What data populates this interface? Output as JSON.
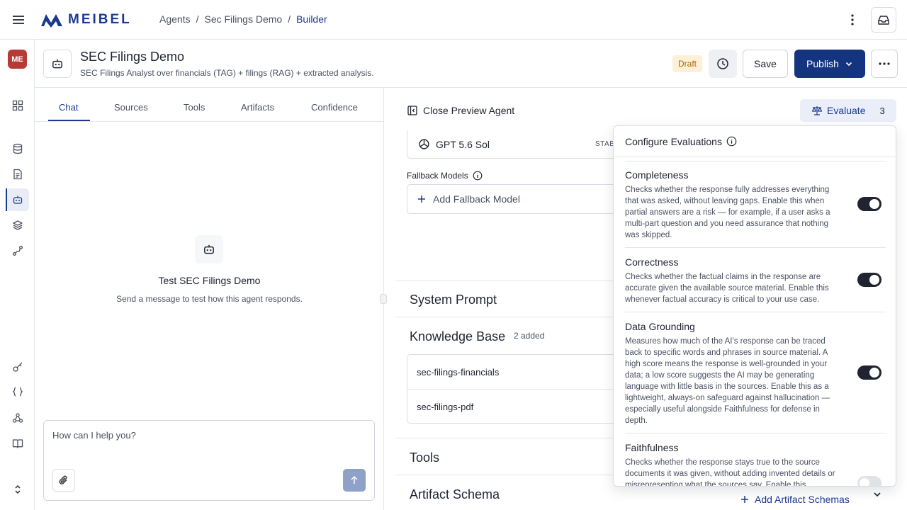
{
  "app": {
    "logo_text": "MEIBEL"
  },
  "breadcrumbs": [
    "Agents",
    "/",
    "Sec Filings Demo",
    "/",
    "Builder"
  ],
  "user": {
    "initials": "ME"
  },
  "agent": {
    "title": "SEC Filings Demo",
    "subtitle": "SEC Filings Analyst over financials (TAG) + filings (RAG) + extracted analysis.",
    "status": "Draft"
  },
  "actions": {
    "save": "Save",
    "publish": "Publish"
  },
  "left_tabs": [
    "Chat",
    "Sources",
    "Tools",
    "Artifacts",
    "Confidence"
  ],
  "chat": {
    "empty_title": "Test SEC Filings Demo",
    "empty_sub": "Send a message to test how this agent responds.",
    "placeholder": "How can I help you?"
  },
  "preview": {
    "close_label": "Close Preview Agent",
    "evaluate_label": "Evaluate",
    "evaluate_count": "3",
    "model_name": "GPT 5.6 Sol",
    "model_tag": "STAB",
    "fallback_label": "Fallback Models",
    "add_fallback": "Add Fallback Model",
    "sections": {
      "system_prompt": "System Prompt",
      "knowledge_base": "Knowledge Base",
      "kb_count": "2 added",
      "tools": "Tools",
      "artifact_schema": "Artifact Schema",
      "add_artifact": "Add Artifact Schemas"
    },
    "kb_items": [
      "sec-filings-financials",
      "sec-filings-pdf"
    ]
  },
  "evaluations": {
    "header": "Configure Evaluations",
    "items": [
      {
        "title": "Completeness",
        "desc": "Checks whether the response fully addresses everything that was asked, without leaving gaps. Enable this when partial answers are a risk — for example, if a user asks a multi-part question and you need assurance that nothing was skipped.",
        "enabled": true
      },
      {
        "title": "Correctness",
        "desc": "Checks whether the factual claims in the response are accurate given the available source material. Enable this whenever factual accuracy is critical to your use case.",
        "enabled": true
      },
      {
        "title": "Data Grounding",
        "desc": "Measures how much of the AI's response can be traced back to specific words and phrases in source material. A high score means the response is well-grounded in your data; a low score suggests the AI may be generating language with little basis in the sources. Enable this as a lightweight, always-on safeguard against hallucination — especially useful alongside Faithfulness for defense in depth.",
        "enabled": true
      },
      {
        "title": "Faithfulness",
        "desc": "Checks whether the response stays true to the source documents it was given, without adding invented details or misrepresenting what the sources say. Enable this",
        "enabled": false
      }
    ]
  },
  "colors": {
    "brand": "#1b3a8f",
    "publish": "#15347f",
    "avatar": "#b83a34",
    "draft_bg": "#fdf0d5"
  }
}
